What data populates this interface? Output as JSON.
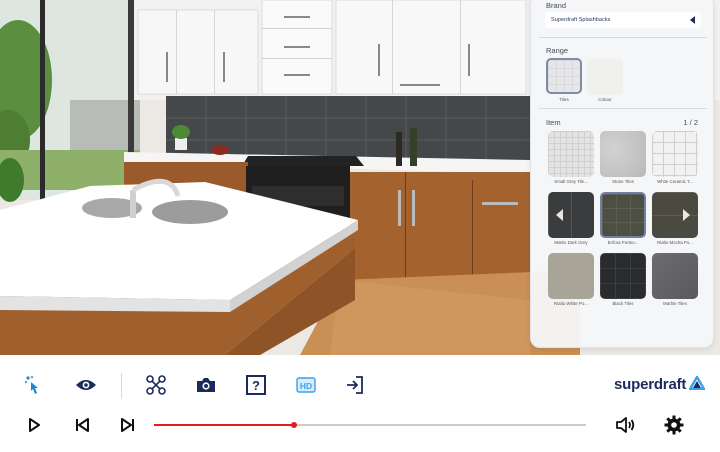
{
  "panel": {
    "brand_label": "Brand",
    "brand_value": "Superdraft Splashbacks",
    "range_label": "Range",
    "range_options": [
      {
        "label": "Tiles",
        "selected": true
      },
      {
        "label": "Colour",
        "selected": false
      }
    ],
    "item_label": "Item",
    "item_page": "1 / 2",
    "items": [
      {
        "label": "Small Grey Tile...",
        "style": "light-grid-small",
        "selected": false
      },
      {
        "label": "Stone Tiles",
        "style": "stone-light",
        "selected": false
      },
      {
        "label": "White Ceramic T...",
        "style": "white-grid",
        "selected": false
      },
      {
        "label": "Matrix Dark Grey",
        "style": "dark-grey",
        "selected": false
      },
      {
        "label": "Enfora Portno...",
        "style": "dark-olive",
        "selected": true
      },
      {
        "label": "Rialto Mocha Po...",
        "style": "mocha",
        "selected": false
      },
      {
        "label": "Rialto White Po...",
        "style": "beige",
        "selected": false
      },
      {
        "label": "Black Tiles",
        "style": "black",
        "selected": false
      },
      {
        "label": "Marble Tiles",
        "style": "marble-grey",
        "selected": false
      }
    ]
  },
  "toolbar": {
    "icons": [
      "touch-icon",
      "eye-icon",
      "drone-icon",
      "camera-icon",
      "help-icon",
      "hd-icon",
      "exit-icon"
    ],
    "brand": "superdraft",
    "accent_color": "#1c2b5e",
    "hd_label": "HD",
    "help_label": "?"
  },
  "player": {
    "progress": 0.325,
    "controls": [
      "play-icon",
      "previous-icon",
      "next-icon",
      "volume-icon",
      "settings-icon"
    ],
    "progress_color": "#e11d1d"
  }
}
